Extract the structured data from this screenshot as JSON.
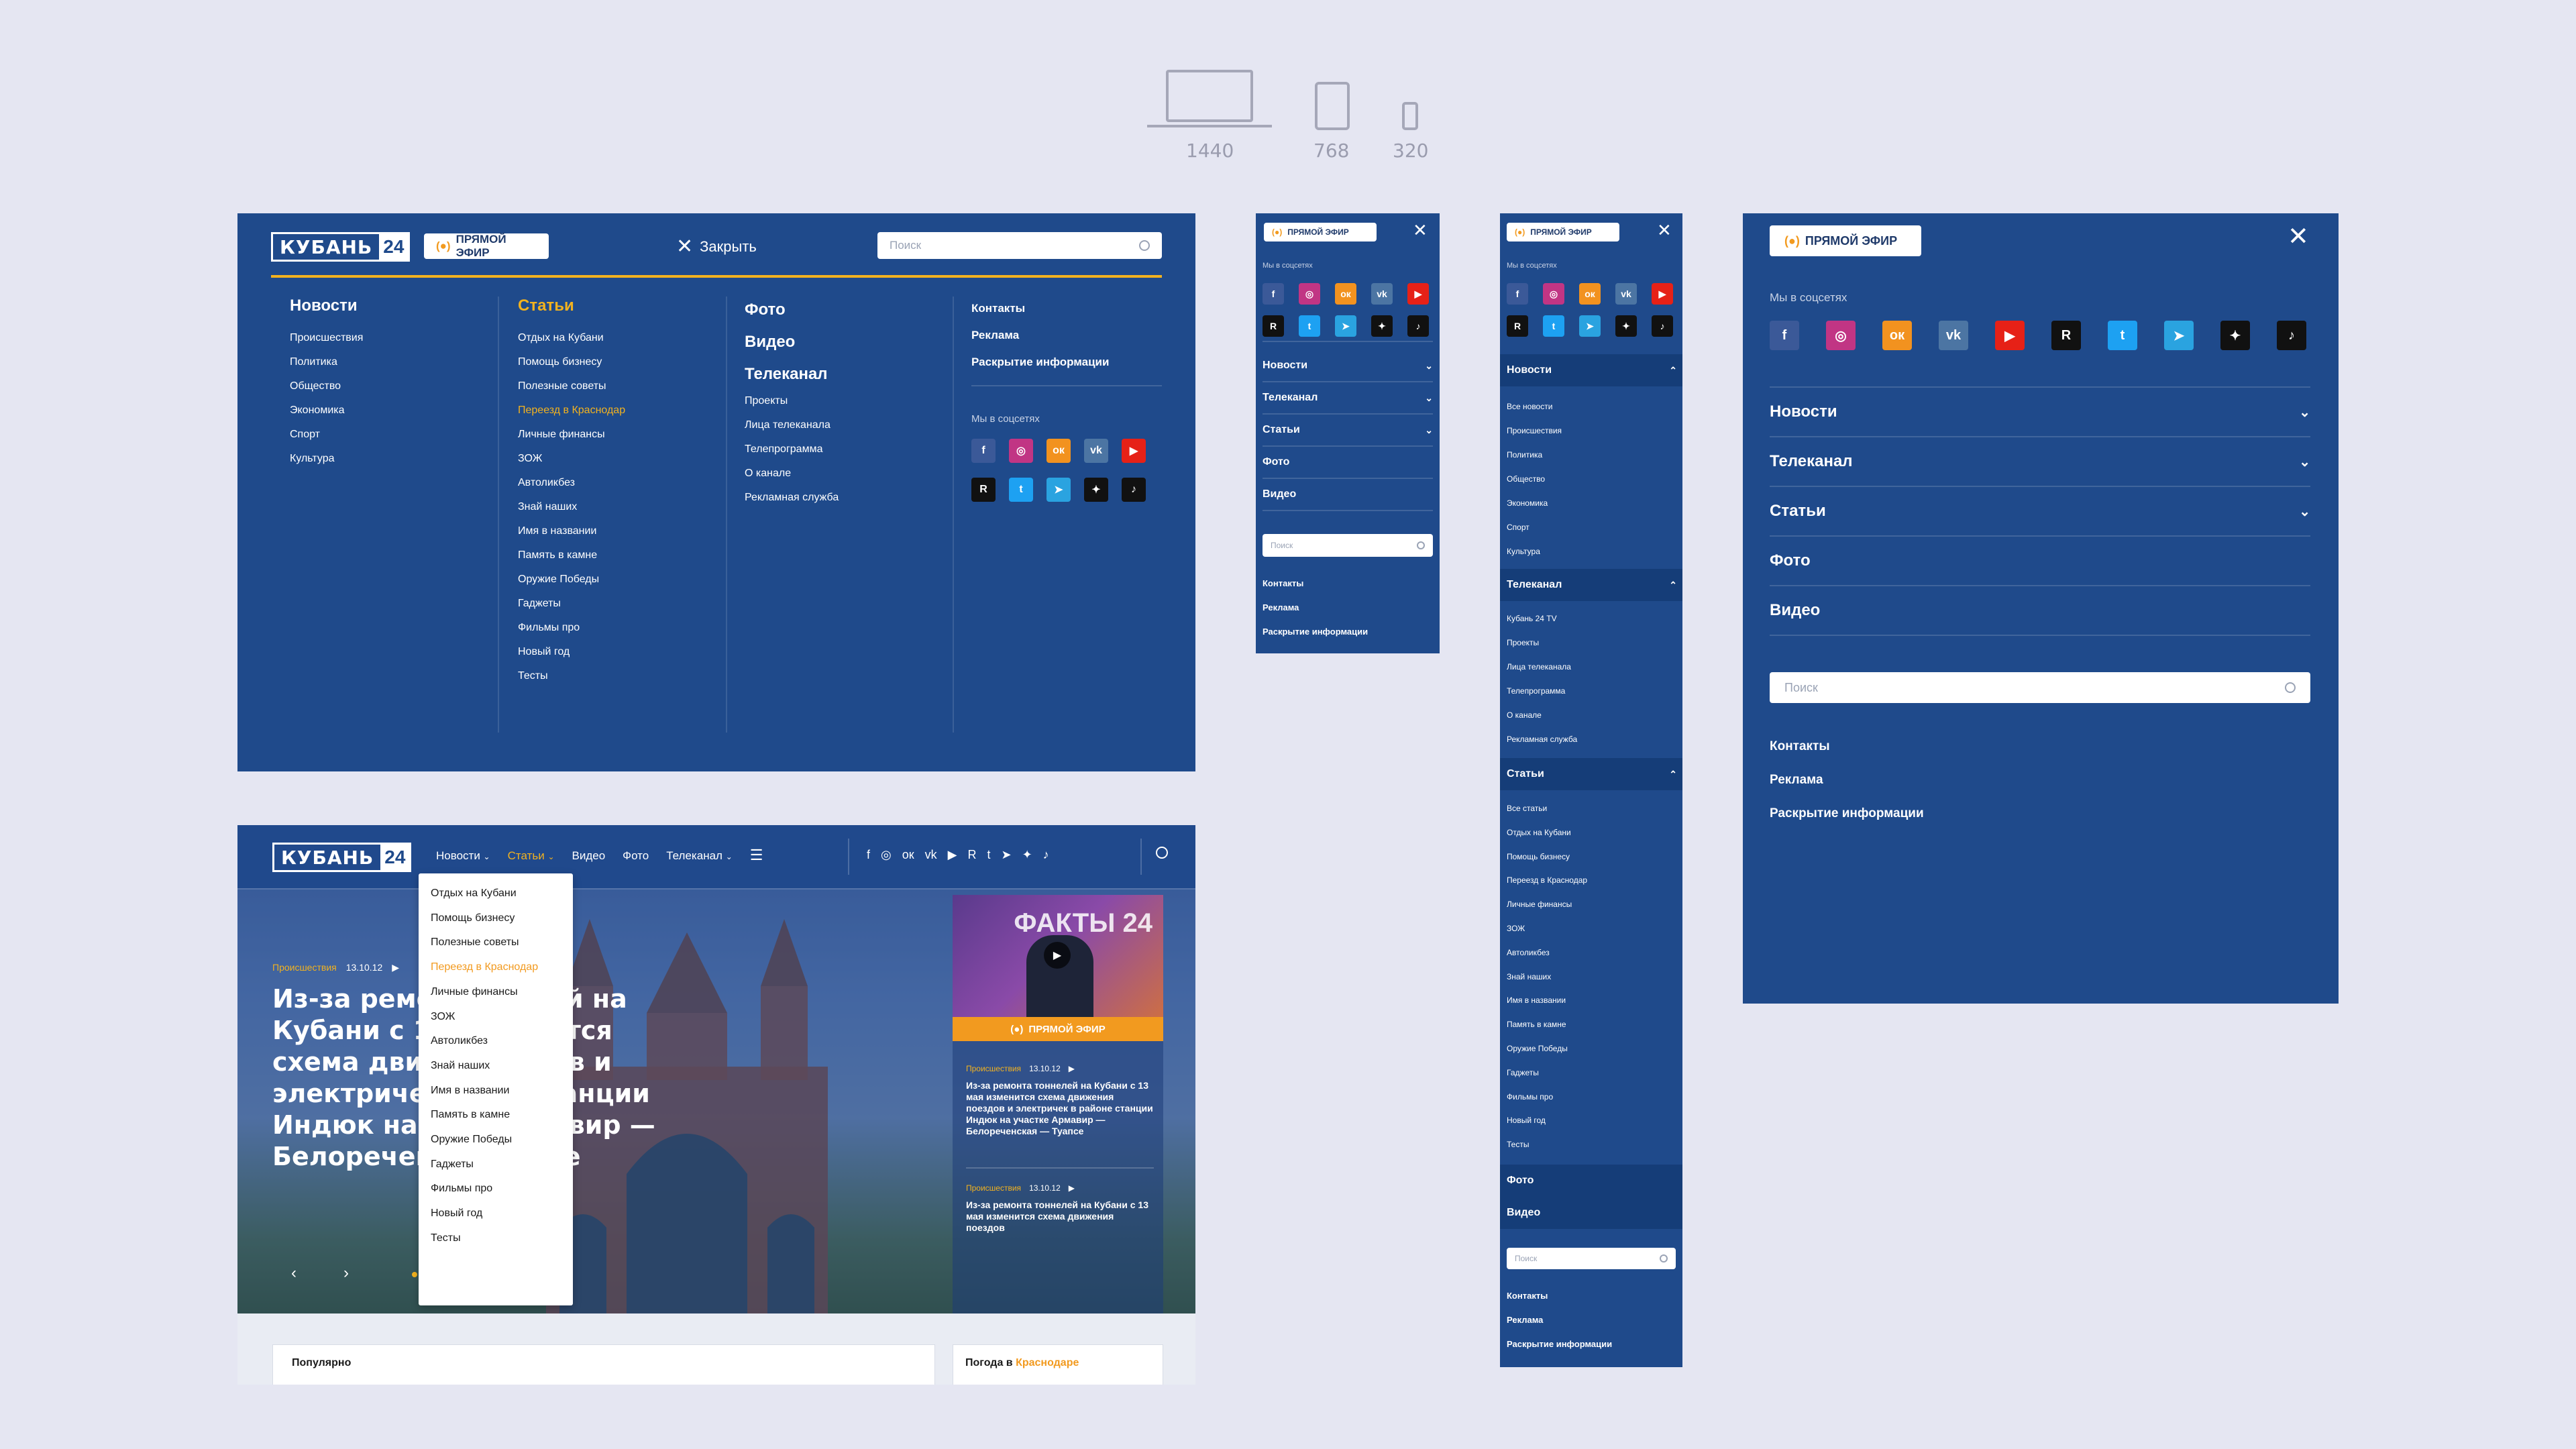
{
  "devices": {
    "labels": [
      "1440",
      "768",
      "320"
    ]
  },
  "logo": {
    "text": "КУБАНЬ",
    "num": "24"
  },
  "live_label": "ПРЯМОЙ ЭФИР",
  "close_label": "Закрыть",
  "search_placeholder": "Поиск",
  "social_title": "Мы в соцсетях",
  "social": [
    {
      "name": "facebook",
      "glyph": "f",
      "color": "#3b5998"
    },
    {
      "name": "instagram",
      "glyph": "◎",
      "color": "#c13584"
    },
    {
      "name": "odnoklassniki",
      "glyph": "ок",
      "color": "#f2921f"
    },
    {
      "name": "vk",
      "glyph": "vk",
      "color": "#4c75a3"
    },
    {
      "name": "youtube",
      "glyph": "▶",
      "color": "#e62117"
    },
    {
      "name": "rutube",
      "glyph": "R",
      "color": "#111111"
    },
    {
      "name": "twitter",
      "glyph": "t",
      "color": "#1da1f2"
    },
    {
      "name": "telegram",
      "glyph": "➤",
      "color": "#2aa3e0"
    },
    {
      "name": "zen",
      "glyph": "✦",
      "color": "#111111"
    },
    {
      "name": "tiktok",
      "glyph": "♪",
      "color": "#111111"
    }
  ],
  "desktop_menu": {
    "col1": {
      "title": "Новости",
      "items": [
        "Происшествия",
        "Политика",
        "Общество",
        "Экономика",
        "Спорт",
        "Культура"
      ]
    },
    "col2": {
      "title": "Статьи",
      "items": [
        "Отдых на Кубани",
        "Помощь бизнесу",
        "Полезные советы",
        "Переезд в Краснодар",
        "Личные финансы",
        "ЗОЖ",
        "Автоликбез",
        "Знай наших",
        "Имя в названии",
        "Память в камне",
        "Оружие Победы",
        "Гаджеты",
        "Фильмы про",
        "Новый год",
        "Тесты"
      ]
    },
    "col3": {
      "titles": [
        "Фото",
        "Видео",
        "Телеканал"
      ],
      "items": [
        "Проекты",
        "Лица телеканала",
        "Телепрограмма",
        "О канале",
        "Рекламная служба"
      ]
    },
    "col4": {
      "links": [
        "Контакты",
        "Реклама",
        "Раскрытие информации"
      ]
    }
  },
  "site": {
    "nav": [
      "Новости",
      "Статьи",
      "Видео",
      "Фото",
      "Телеканал"
    ],
    "dropdown": [
      "Отдых на Кубани",
      "Помощь бизнесу",
      "Полезные советы",
      "Переезд в Краснодар",
      "Личные финансы",
      "ЗОЖ",
      "Автоликбез",
      "Знай наших",
      "Имя в названии",
      "Память в камне",
      "Оружие Победы",
      "Гаджеты",
      "Фильмы про",
      "Новый год",
      "Тесты"
    ],
    "hero_tag": "Происшествия",
    "hero_date": "13.10.12",
    "hero_title": "Из-за ремонта тоннелей на Кубани с 13 мая изменится схема движения поездов и электричек в районе станции Индюк на участке Армавир — Белореченская — Туапсе",
    "hero_visible_lines": [
      "Из-за ремо",
      "ней на",
      "Кубани с 1",
      "нится",
      "схема движ",
      "дов и",
      "электриче",
      "станции",
      "Индюк на у",
      "мавир —",
      "Белоречен",
      "псе"
    ],
    "tv_label": "ФАКТЫ 24",
    "side_news": [
      {
        "tag": "Происшествия",
        "date": "13.10.12",
        "title": "Из-за ремонта тоннелей на Кубани с 13 мая изменится схема движения поездов и электричек в районе станции Индюк на участке Армавир — Белореченская — Туапсе"
      },
      {
        "tag": "Происшествия",
        "date": "13.10.12",
        "title": "Из-за ремонта тоннелей на Кубани с 13 мая изменится схема движения поездов"
      }
    ],
    "popular": "Популярно",
    "weather": "Погода в",
    "weather_city": "Краснодаре"
  },
  "mobile_menu": {
    "sections": [
      "Новости",
      "Телеканал",
      "Статьи",
      "Фото",
      "Видео"
    ],
    "links": [
      "Контакты",
      "Реклама",
      "Раскрытие информации"
    ]
  },
  "mobile_open": {
    "news": [
      "Все новости",
      "Происшествия",
      "Политика",
      "Общество",
      "Экономика",
      "Спорт",
      "Культура"
    ],
    "tv": [
      "Кубань 24 TV",
      "Проекты",
      "Лица телеканала",
      "Телепрограмма",
      "О канале",
      "Рекламная служба"
    ],
    "articles": [
      "Все статьи",
      "Отдых на Кубани",
      "Помощь бизнесу",
      "Переезд в Краснодар",
      "Личные финансы",
      "ЗОЖ",
      "Автоликбез",
      "Знай наших",
      "Имя в названии",
      "Память в камне",
      "Оружие Победы",
      "Гаджеты",
      "Фильмы про",
      "Новый год",
      "Тесты"
    ]
  },
  "colors": {
    "panel": "#1f4a8b",
    "accent": "#f2b21f",
    "orange": "#f29a1f",
    "bg": "#e5e6f2"
  }
}
